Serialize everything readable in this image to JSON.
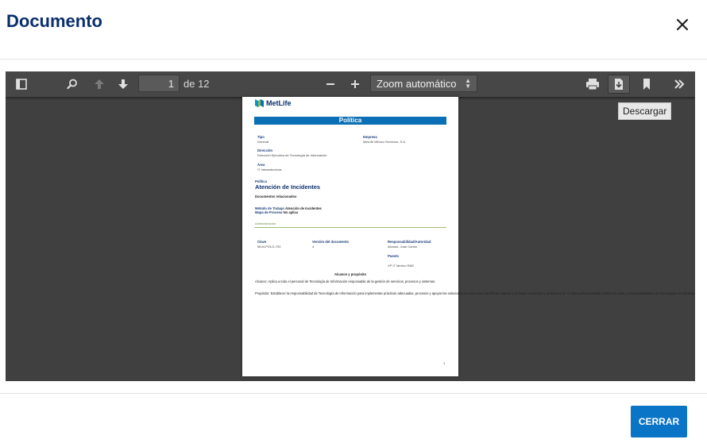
{
  "modal": {
    "title": "Documento",
    "close_icon": "close-icon"
  },
  "toolbar": {
    "page_number": "1",
    "page_count": "de 12",
    "zoom": "Zoom automático",
    "tooltip": "Descargar"
  },
  "pdf": {
    "logo": "MetLife",
    "banner": "Política",
    "tipo_label": "Tipo",
    "tipo_value": "General",
    "empresa_label": "Empresa",
    "empresa_value": "MetLife México Servicios, S.A.",
    "direccion_label": "Dirección",
    "direccion_value": "Dirección Ejecutiva de Tecnología de Información",
    "area_label": "Área",
    "area_value": "IT Infraestructura",
    "politica_label": "Política",
    "politica_title": "Atención de Incidentes",
    "docs_label": "Documentos relacionados",
    "metodo_label": "Método de Trabajo",
    "metodo_value": "Atención de Incidentes",
    "mapa_label": "Mapa de Proceso",
    "mapa_value": "No aplica",
    "admin_label": "Administración",
    "clave_label": "Clave",
    "clave_value": "MLM-POLG-703",
    "version_label": "Versión del documento",
    "version_value": "4",
    "resp_label": "Responsabilidad/Autoridad",
    "resp_value": "Alcaraz, Juan Carlos",
    "puesto_label": "Puesto",
    "puesto_value": "VP IT Mexico RAD",
    "alcance_heading": "Alcance y propósito",
    "alcance_text": "Alcance: Aplica a todo el personal de Tecnología de Información responsable de la gestión de servicios, procesos y sistemas.",
    "proposito_text": "Propósito: Establecer la responsabilidad de Tecnología de Información para implementar prácticas adecuadas, procesos y apoyar las soluciones técnicas para identificar, rastrear y remediar incidentes y problemas de TI. Esta política también define los roles y responsabilidades de Tecnologías de Información y otros grupos y personal encargado de responder a los problemas de TI.",
    "page_num": "1"
  },
  "footer": {
    "close_button": "CERRAR"
  },
  "colors": {
    "title": "#0a2f6c",
    "button": "#0a74c7",
    "viewer_bg": "#404040",
    "banner": "#0a6fb5"
  }
}
